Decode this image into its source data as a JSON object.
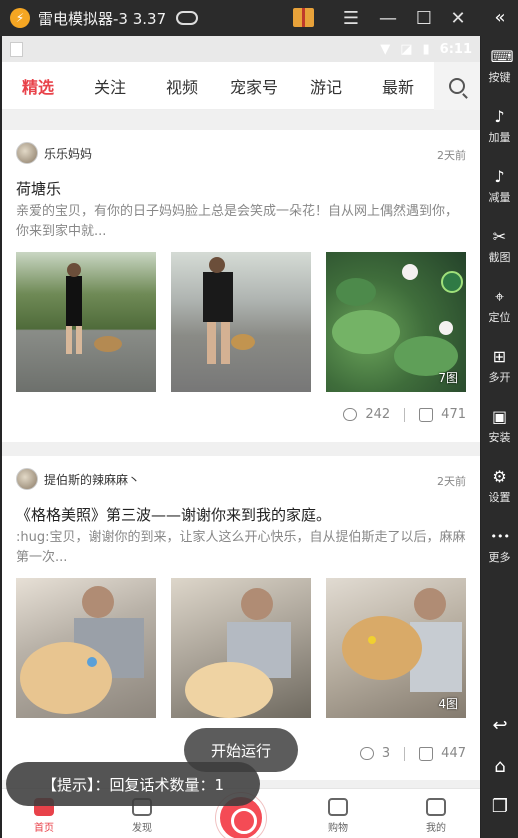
{
  "titlebar": {
    "app_title": "雷电模拟器-3 3.37",
    "menu_glyph": "☰",
    "minimize_glyph": "—",
    "maximize_glyph": "☐",
    "close_glyph": "✕"
  },
  "statusbar": {
    "time": "6:11"
  },
  "tabs": [
    "精选",
    "关注",
    "视频",
    "宠家号",
    "游记",
    "最新"
  ],
  "posts": [
    {
      "author": "乐乐妈妈",
      "time_ago": "2天前",
      "title": "荷塘乐",
      "excerpt": "亲爱的宝贝，有你的日子妈妈脸上总是会笑成一朵花！自从网上偶然遇到你，你来到家中就...",
      "pic_count": "7图",
      "comments": "242",
      "likes": "471"
    },
    {
      "author": "提伯斯的辣麻麻丶",
      "time_ago": "2天前",
      "title": "《格格美照》第三波——谢谢你来到我的家庭。",
      "excerpt": ":hug:宝贝，谢谢你的到来，让家人这么开心快乐，自从提伯斯走了以后，麻麻第一次...",
      "pic_count": "4图",
      "comments": "3",
      "likes": "447"
    }
  ],
  "bottomnav": {
    "home": "首页",
    "discover": "发现",
    "shop": "购物",
    "mine": "我的"
  },
  "overlay": {
    "run_button": "开始运行",
    "hint": "【提示】：回复话术数量：1"
  },
  "sidebar": {
    "collapse_glyph": "«",
    "items": [
      {
        "label": "按键",
        "icon": "keyboard-icon",
        "glyph": "⌨"
      },
      {
        "label": "加量",
        "icon": "volume-up-icon",
        "glyph": "♪"
      },
      {
        "label": "减量",
        "icon": "volume-down-icon",
        "glyph": "♪"
      },
      {
        "label": "截图",
        "icon": "scissors-icon",
        "glyph": "✂"
      },
      {
        "label": "定位",
        "icon": "location-pin-icon",
        "glyph": "⌖"
      },
      {
        "label": "多开",
        "icon": "multi-instance-icon",
        "glyph": "⊞"
      },
      {
        "label": "安装",
        "icon": "apk-install-icon",
        "glyph": "▣"
      },
      {
        "label": "设置",
        "icon": "gear-icon",
        "glyph": "⚙"
      },
      {
        "label": "更多",
        "icon": "more-dots-icon",
        "glyph": "•••"
      }
    ],
    "nav": {
      "back_glyph": "↩",
      "home_glyph": "⌂",
      "recents_glyph": "❐"
    }
  },
  "colors": {
    "accent": "#e8424a",
    "emulator_chrome": "#2b2b2b"
  }
}
